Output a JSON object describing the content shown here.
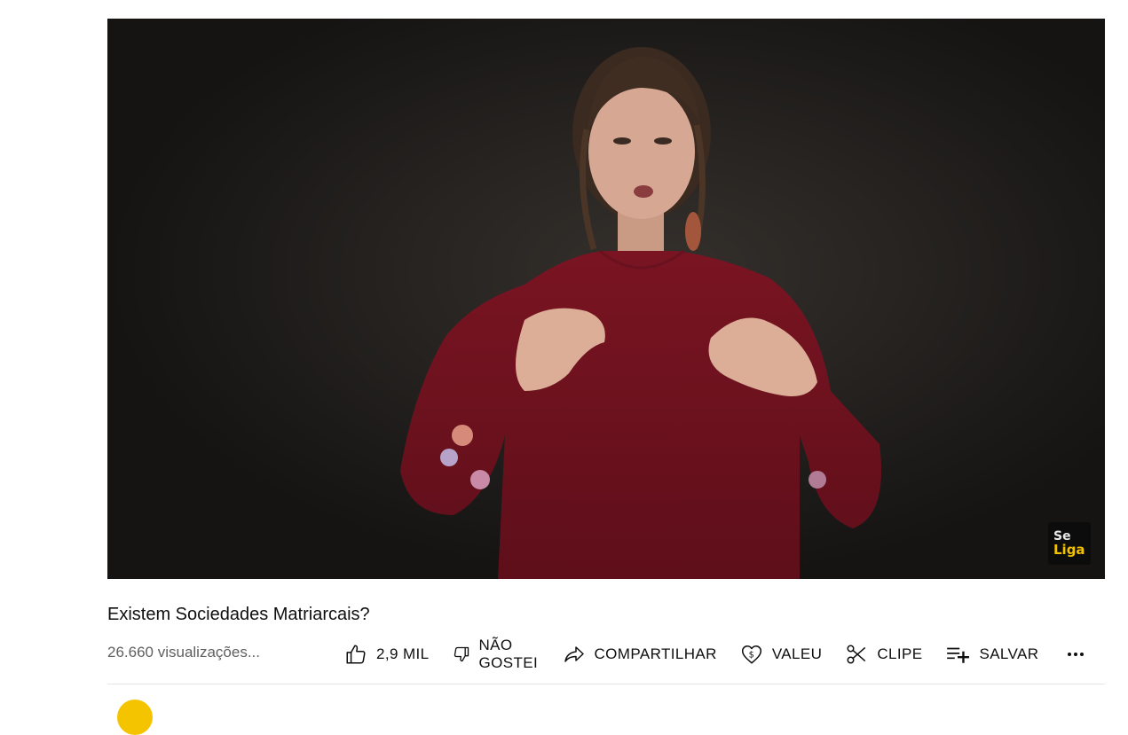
{
  "video": {
    "watermark_line1": "Se",
    "watermark_line2": "Liga"
  },
  "title": "Existem Sociedades Matriarcais?",
  "views": "26.660 visualizações...",
  "actions": {
    "like_count": "2,9 MIL",
    "dislike_label": "NÃO GOSTEI",
    "share_label": "COMPARTILHAR",
    "thanks_label": "VALEU",
    "clip_label": "CLIPE",
    "save_label": "SALVAR"
  },
  "icons": {
    "like": "thumbs-up-icon",
    "dislike": "thumbs-down-icon",
    "share": "share-arrow-icon",
    "thanks": "heart-dollar-icon",
    "clip": "scissors-icon",
    "save": "playlist-add-icon",
    "more": "more-horizontal-icon"
  },
  "colors": {
    "channel_avatar": "#f5c400",
    "watermark_accent": "#f2c200"
  }
}
